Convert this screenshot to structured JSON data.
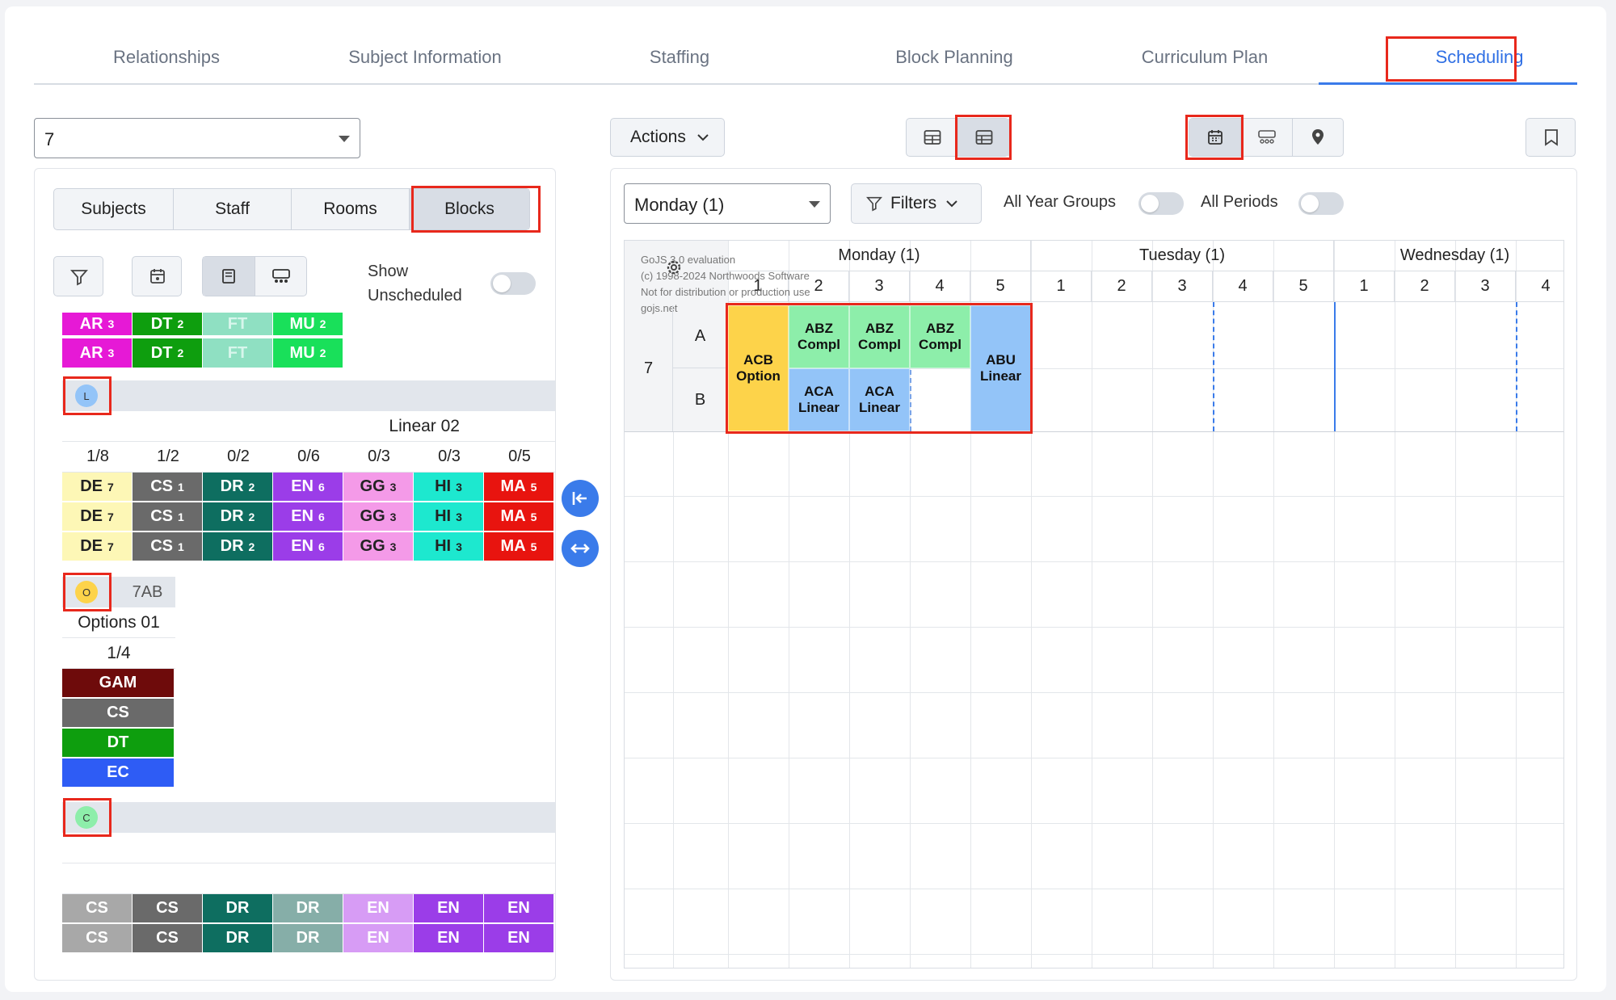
{
  "tabs": [
    "Relationships",
    "Subject Information",
    "Staffing",
    "Block Planning",
    "Curriculum Plan",
    "Scheduling"
  ],
  "active_tab_index": 5,
  "year_select": {
    "value": "7"
  },
  "left_panel": {
    "subtabs": [
      "Subjects",
      "Staff",
      "Rooms",
      "Blocks"
    ],
    "active_subtab": "Blocks",
    "show_unscheduled_line1": "Show",
    "show_unscheduled_line2": "Unscheduled",
    "top_rows": [
      [
        {
          "t": "AR",
          "n": "3",
          "c": "#e619d6"
        },
        {
          "t": "DT",
          "n": "2",
          "c": "#0e9e0e"
        },
        {
          "t": "FT",
          "n": "",
          "c": "#8fe0c2"
        },
        {
          "t": "MU",
          "n": "2",
          "c": "#19e05a"
        }
      ],
      [
        {
          "t": "AR",
          "n": "3",
          "c": "#e619d6"
        },
        {
          "t": "DT",
          "n": "2",
          "c": "#0e9e0e"
        },
        {
          "t": "FT",
          "n": "",
          "c": "#8fe0c2"
        },
        {
          "t": "MU",
          "n": "2",
          "c": "#19e05a"
        }
      ]
    ],
    "linear": {
      "badge": "L",
      "title": "Linear 02",
      "ratios": [
        "1/8",
        "1/2",
        "0/2",
        "0/6",
        "0/3",
        "0/3",
        "0/5"
      ],
      "cols": [
        {
          "t": "DE",
          "n": "7",
          "c": "#fdf7b6",
          "fg": "#222"
        },
        {
          "t": "CS",
          "n": "1",
          "c": "#6a6a6a",
          "fg": "#fff"
        },
        {
          "t": "DR",
          "n": "2",
          "c": "#0e6e60",
          "fg": "#fff"
        },
        {
          "t": "EN",
          "n": "6",
          "c": "#9b3de8",
          "fg": "#fff"
        },
        {
          "t": "GG",
          "n": "3",
          "c": "#f49ae8",
          "fg": "#222"
        },
        {
          "t": "HI",
          "n": "3",
          "c": "#1de8cf",
          "fg": "#222"
        },
        {
          "t": "MA",
          "n": "5",
          "c": "#e8140f",
          "fg": "#fff"
        }
      ]
    },
    "options": {
      "badge": "O",
      "group": "7AB",
      "title": "Options 01",
      "ratio": "1/4",
      "items": [
        {
          "t": "GAM",
          "c": "#6e0b0b"
        },
        {
          "t": "CS",
          "c": "#6a6a6a"
        },
        {
          "t": "DT",
          "c": "#0e9e0e"
        },
        {
          "t": "EC",
          "c": "#2e5cf5"
        }
      ]
    },
    "core": {
      "badge": "C",
      "rows": [
        [
          {
            "t": "CS",
            "c": "#a8a8a8"
          },
          {
            "t": "CS",
            "c": "#6a6a6a"
          },
          {
            "t": "DR",
            "c": "#0e6e60"
          },
          {
            "t": "DR",
            "c": "#86aea8"
          },
          {
            "t": "EN",
            "c": "#d79cf5"
          },
          {
            "t": "EN",
            "c": "#9b3de8"
          },
          {
            "t": "EN",
            "c": "#9b3de8"
          }
        ],
        [
          {
            "t": "CS",
            "c": "#a8a8a8"
          },
          {
            "t": "CS",
            "c": "#6a6a6a"
          },
          {
            "t": "DR",
            "c": "#0e6e60"
          },
          {
            "t": "DR",
            "c": "#86aea8"
          },
          {
            "t": "EN",
            "c": "#d79cf5"
          },
          {
            "t": "EN",
            "c": "#9b3de8"
          },
          {
            "t": "EN",
            "c": "#9b3de8"
          }
        ]
      ]
    }
  },
  "right_panel": {
    "actions_label": "Actions",
    "day_select": "Monday (1)",
    "filters_label": "Filters",
    "all_year_groups": "All Year Groups",
    "all_periods": "All Periods",
    "watermark": [
      "GoJS 3.0 evaluation",
      "(c) 1998-2024 Northwoods Software",
      "Not for distribution or production use",
      "gojs.net"
    ],
    "days": [
      {
        "label": "Monday (1)",
        "periods": [
          "1",
          "2",
          "3",
          "4",
          "5"
        ]
      },
      {
        "label": "Tuesday (1)",
        "periods": [
          "1",
          "2",
          "3",
          "4",
          "5"
        ]
      },
      {
        "label": "Wednesday (1)",
        "periods": [
          "1",
          "2",
          "3",
          "4"
        ]
      }
    ],
    "year": "7",
    "rows": [
      "A",
      "B"
    ],
    "lessons": {
      "acb": "ACB\nOption",
      "abz1": "ABZ\nCompl",
      "abz2": "ABZ\nCompl",
      "abz3": "ABZ\nCompl",
      "abu": "ABU\nLinear",
      "aca1": "ACA\nLinear",
      "aca2": "ACA\nLinear"
    },
    "colors": {
      "option": "#fdd34a",
      "compl": "#8deeaa",
      "linear": "#93c4f8",
      "highlight": "#e8281c",
      "accent": "#3a7bea"
    }
  }
}
